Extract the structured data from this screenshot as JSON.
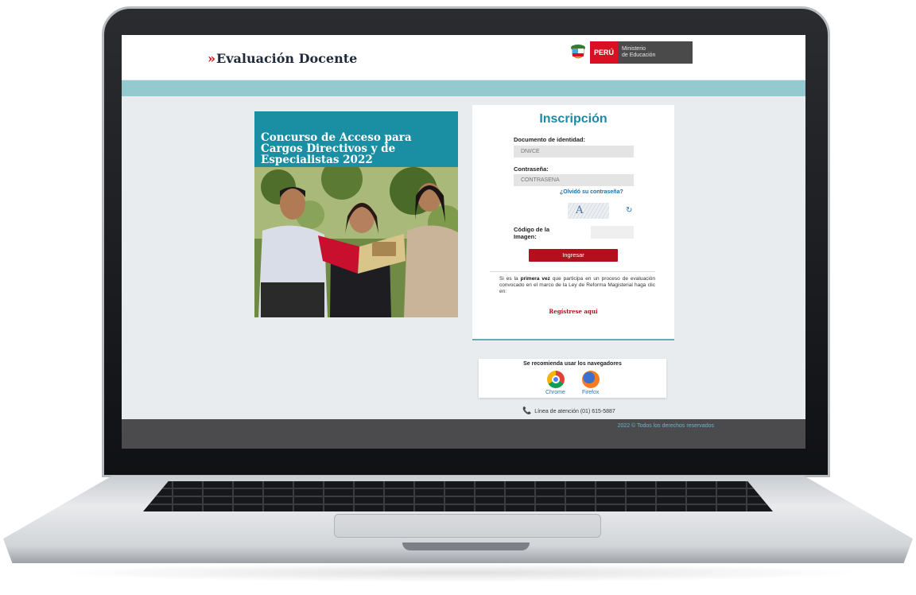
{
  "header": {
    "brand_mark": "»",
    "brand": "Evaluación Docente",
    "peru": "PERÚ",
    "ministry_line1": "Ministerio",
    "ministry_line2": "de Educación"
  },
  "banner": {
    "title": "Concurso de Acceso para Cargos Directivos y de Especialistas 2022"
  },
  "login": {
    "title": "Inscripción",
    "document_label": "Documento de identidad:",
    "document_placeholder": "DNI/CE",
    "password_label": "Contraseña:",
    "password_placeholder": "CONTRASEÑA",
    "forgot": "¿Olvidó su contraseña?",
    "captcha_text": "A",
    "captcha_label": "Código de la Imagen:",
    "submit": "Ingresar",
    "info_prefix": "Si es la ",
    "info_bold": "primera vez",
    "info_suffix": " que participa en un proceso de evaluación convocado en el marco de la Ley de Reforma Magisterial haga clic en:",
    "register": "Regístrese aquí"
  },
  "browsers": {
    "title": "Se recomienda usar los navegadores",
    "items": [
      {
        "name": "Chrome",
        "icon": "chrome-icon"
      },
      {
        "name": "Firefox",
        "icon": "firefox-icon"
      }
    ]
  },
  "support": {
    "icon": "phone-icon",
    "text": "Línea de atención (01) 615-5887"
  },
  "footer": {
    "copyright": "2022 © Todos los derechos reservados"
  },
  "colors": {
    "teal_band": "#94c9cf",
    "title_teal": "#1b8aa5",
    "banner": "#1a8ea2",
    "brand_red": "#b3101e",
    "footer": "#4b4b4d"
  }
}
